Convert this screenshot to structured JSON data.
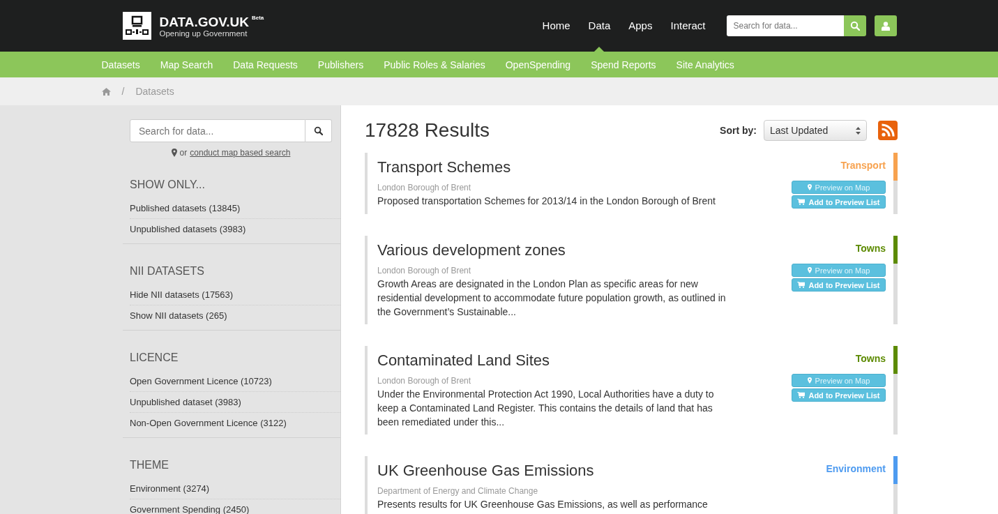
{
  "brand": {
    "title": "DATA.GOV.UK",
    "badge": "Beta",
    "subtitle": "Opening up Government"
  },
  "top_nav": [
    {
      "label": "Home",
      "selected": false
    },
    {
      "label": "Data",
      "selected": true
    },
    {
      "label": "Apps",
      "selected": false
    },
    {
      "label": "Interact",
      "selected": false
    }
  ],
  "header_search": {
    "placeholder": "Search for data..."
  },
  "sub_nav": [
    "Datasets",
    "Map Search",
    "Data Requests",
    "Publishers",
    "Public Roles & Salaries",
    "OpenSpending",
    "Spend Reports",
    "Site Analytics"
  ],
  "breadcrumb_separator": "/",
  "breadcrumb": [
    "Datasets"
  ],
  "sidebar": {
    "search": {
      "placeholder": "Search for data..."
    },
    "map_hint": "or",
    "map_link": "conduct map based search",
    "facets": [
      {
        "heading": "SHOW ONLY...",
        "items": [
          "Published datasets (13845)",
          "Unpublished datasets (3983)"
        ]
      },
      {
        "heading": "NII DATASETS",
        "items": [
          "Hide NII datasets (17563)",
          "Show NII datasets (265)"
        ]
      },
      {
        "heading": "LICENCE",
        "items": [
          "Open Government Licence (10723)",
          "Unpublished dataset (3983)",
          "Non-Open Government Licence (3122)"
        ]
      },
      {
        "heading": "THEME",
        "items": [
          "Environment (3274)",
          "Government Spending (2450)"
        ]
      }
    ]
  },
  "results": {
    "count": "17828 Results",
    "sort_label": "Sort by:",
    "sort_value": "Last Updated",
    "items": [
      {
        "title": "Transport Schemes",
        "publisher": "London Borough of Brent",
        "description": "Proposed transportation Schemes for 2013/14 in the London Borough of Brent",
        "theme": "Transport",
        "color": "#f7a24f",
        "buttons": [
          "Preview on Map",
          "Add to Preview List"
        ]
      },
      {
        "title": "Various development zones",
        "publisher": "London Borough of Brent",
        "description": "Growth Areas are designated in the London Plan as specific areas for new residential development to accommodate future population growth, as outlined in the Government’s Sustainable...",
        "theme": "Towns",
        "color": "#5c8a00",
        "buttons": [
          "Preview on Map",
          "Add to Preview List"
        ]
      },
      {
        "title": "Contaminated Land Sites",
        "publisher": "London Borough of Brent",
        "description": "Under the Environmental Protection Act 1990, Local Authorities have a duty to keep a Contaminated Land Register. This contains the details of land that has been remediated under this...",
        "theme": "Towns",
        "color": "#5c8a00",
        "buttons": [
          "Preview on Map",
          "Add to Preview List"
        ]
      },
      {
        "title": "UK Greenhouse Gas Emissions",
        "publisher": "Department of Energy and Climate Change",
        "description": "Presents results for UK Greenhouse Gas Emissions, as well as performance",
        "theme": "Environment",
        "color": "#4e9bf0"
      }
    ]
  }
}
